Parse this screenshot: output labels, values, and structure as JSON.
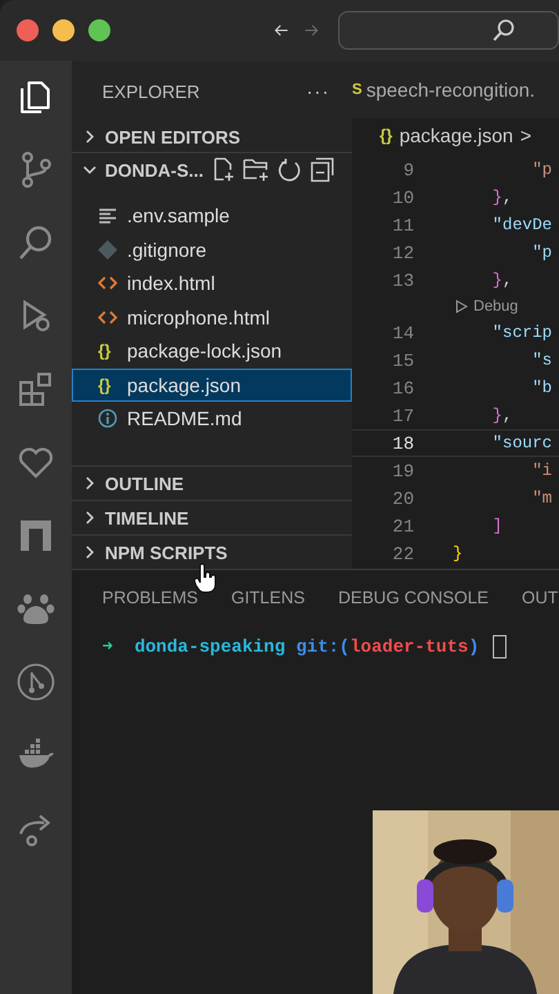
{
  "activity_bar": [
    {
      "kind": "files",
      "selected": true
    },
    {
      "kind": "source-control",
      "selected": false
    },
    {
      "kind": "search",
      "selected": false
    },
    {
      "kind": "debug",
      "selected": false
    },
    {
      "kind": "extensions",
      "selected": false
    },
    {
      "kind": "heart",
      "selected": false
    },
    {
      "kind": "square",
      "selected": false
    },
    {
      "kind": "paw",
      "selected": false
    },
    {
      "kind": "graph",
      "selected": false
    },
    {
      "kind": "whale",
      "selected": false
    },
    {
      "kind": "share",
      "selected": false
    }
  ],
  "explorer": {
    "title": "EXPLORER",
    "more": "···",
    "open_editors": {
      "label": "OPEN EDITORS",
      "expanded": false
    },
    "folder": {
      "label": "DONDA-S...",
      "expanded": true
    },
    "files": [
      {
        "name": ".env.sample",
        "kind": "text",
        "selected": false
      },
      {
        "name": ".gitignore",
        "kind": "git",
        "selected": false
      },
      {
        "name": "index.html",
        "kind": "html",
        "selected": false
      },
      {
        "name": "microphone.html",
        "kind": "html",
        "selected": false
      },
      {
        "name": "package-lock.json",
        "kind": "json",
        "glyph": "{}",
        "selected": false
      },
      {
        "name": "package.json",
        "kind": "json",
        "glyph": "{}",
        "selected": true
      },
      {
        "name": "README.md",
        "kind": "info",
        "selected": false
      }
    ],
    "sections": [
      {
        "label": "OUTLINE",
        "expanded": false
      },
      {
        "label": "TIMELINE",
        "expanded": false
      },
      {
        "label": "NPM SCRIPTS",
        "expanded": false
      }
    ]
  },
  "editor": {
    "tab": {
      "icon_text": "S",
      "label": "speech-recongition."
    },
    "breadcrumb": {
      "glyph": "{}",
      "file": "package.json",
      "separator": ">"
    },
    "lines": [
      {
        "kind": "code",
        "number": "9",
        "current": false,
        "segments": [
          {
            "text": "        \"p",
            "color": "#ce9178"
          }
        ]
      },
      {
        "kind": "code",
        "number": "10",
        "current": false,
        "segments": [
          {
            "text": "    }",
            "color": "#da70d6"
          },
          {
            "text": ",",
            "color": "#d4d4d4"
          }
        ]
      },
      {
        "kind": "code",
        "number": "11",
        "current": false,
        "segments": [
          {
            "text": "    \"devDe",
            "color": "#9cdcfe"
          }
        ]
      },
      {
        "kind": "code",
        "number": "12",
        "current": false,
        "segments": [
          {
            "text": "        \"p",
            "color": "#9cdcfe"
          }
        ]
      },
      {
        "kind": "code",
        "number": "13",
        "current": false,
        "segments": [
          {
            "text": "    }",
            "color": "#da70d6"
          },
          {
            "text": ",",
            "color": "#d4d4d4"
          }
        ]
      },
      {
        "kind": "codelens",
        "text": "Debug"
      },
      {
        "kind": "code",
        "number": "14",
        "current": false,
        "segments": [
          {
            "text": "    \"scrip",
            "color": "#9cdcfe"
          }
        ]
      },
      {
        "kind": "code",
        "number": "15",
        "current": false,
        "segments": [
          {
            "text": "        \"s",
            "color": "#9cdcfe"
          }
        ]
      },
      {
        "kind": "code",
        "number": "16",
        "current": false,
        "segments": [
          {
            "text": "        \"b",
            "color": "#9cdcfe"
          }
        ]
      },
      {
        "kind": "code",
        "number": "17",
        "current": false,
        "segments": [
          {
            "text": "    }",
            "color": "#da70d6"
          },
          {
            "text": ",",
            "color": "#d4d4d4"
          }
        ]
      },
      {
        "kind": "code",
        "number": "18",
        "current": true,
        "segments": [
          {
            "text": "    \"sourc",
            "color": "#9cdcfe"
          }
        ]
      },
      {
        "kind": "code",
        "number": "19",
        "current": false,
        "segments": [
          {
            "text": "        \"i",
            "color": "#ce9178"
          }
        ]
      },
      {
        "kind": "code",
        "number": "20",
        "current": false,
        "segments": [
          {
            "text": "        \"m",
            "color": "#ce9178"
          }
        ]
      },
      {
        "kind": "code",
        "number": "21",
        "current": false,
        "segments": [
          {
            "text": "    ]",
            "color": "#da70d6"
          }
        ]
      },
      {
        "kind": "code",
        "number": "22",
        "current": false,
        "segments": [
          {
            "text": "}",
            "color": "#ffd700"
          }
        ]
      }
    ]
  },
  "panel": {
    "tabs": [
      "PROBLEMS",
      "GITLENS",
      "DEBUG CONSOLE",
      "OUT"
    ],
    "terminal": [
      {
        "text": "➜ ",
        "color": "#23d18b"
      },
      {
        "text": " donda-speaking ",
        "color": "#29b8db"
      },
      {
        "text": "git:(",
        "color": "#3b8eea"
      },
      {
        "text": "loader-tuts",
        "color": "#f14c4c"
      },
      {
        "text": ") ",
        "color": "#3b8eea"
      }
    ]
  }
}
